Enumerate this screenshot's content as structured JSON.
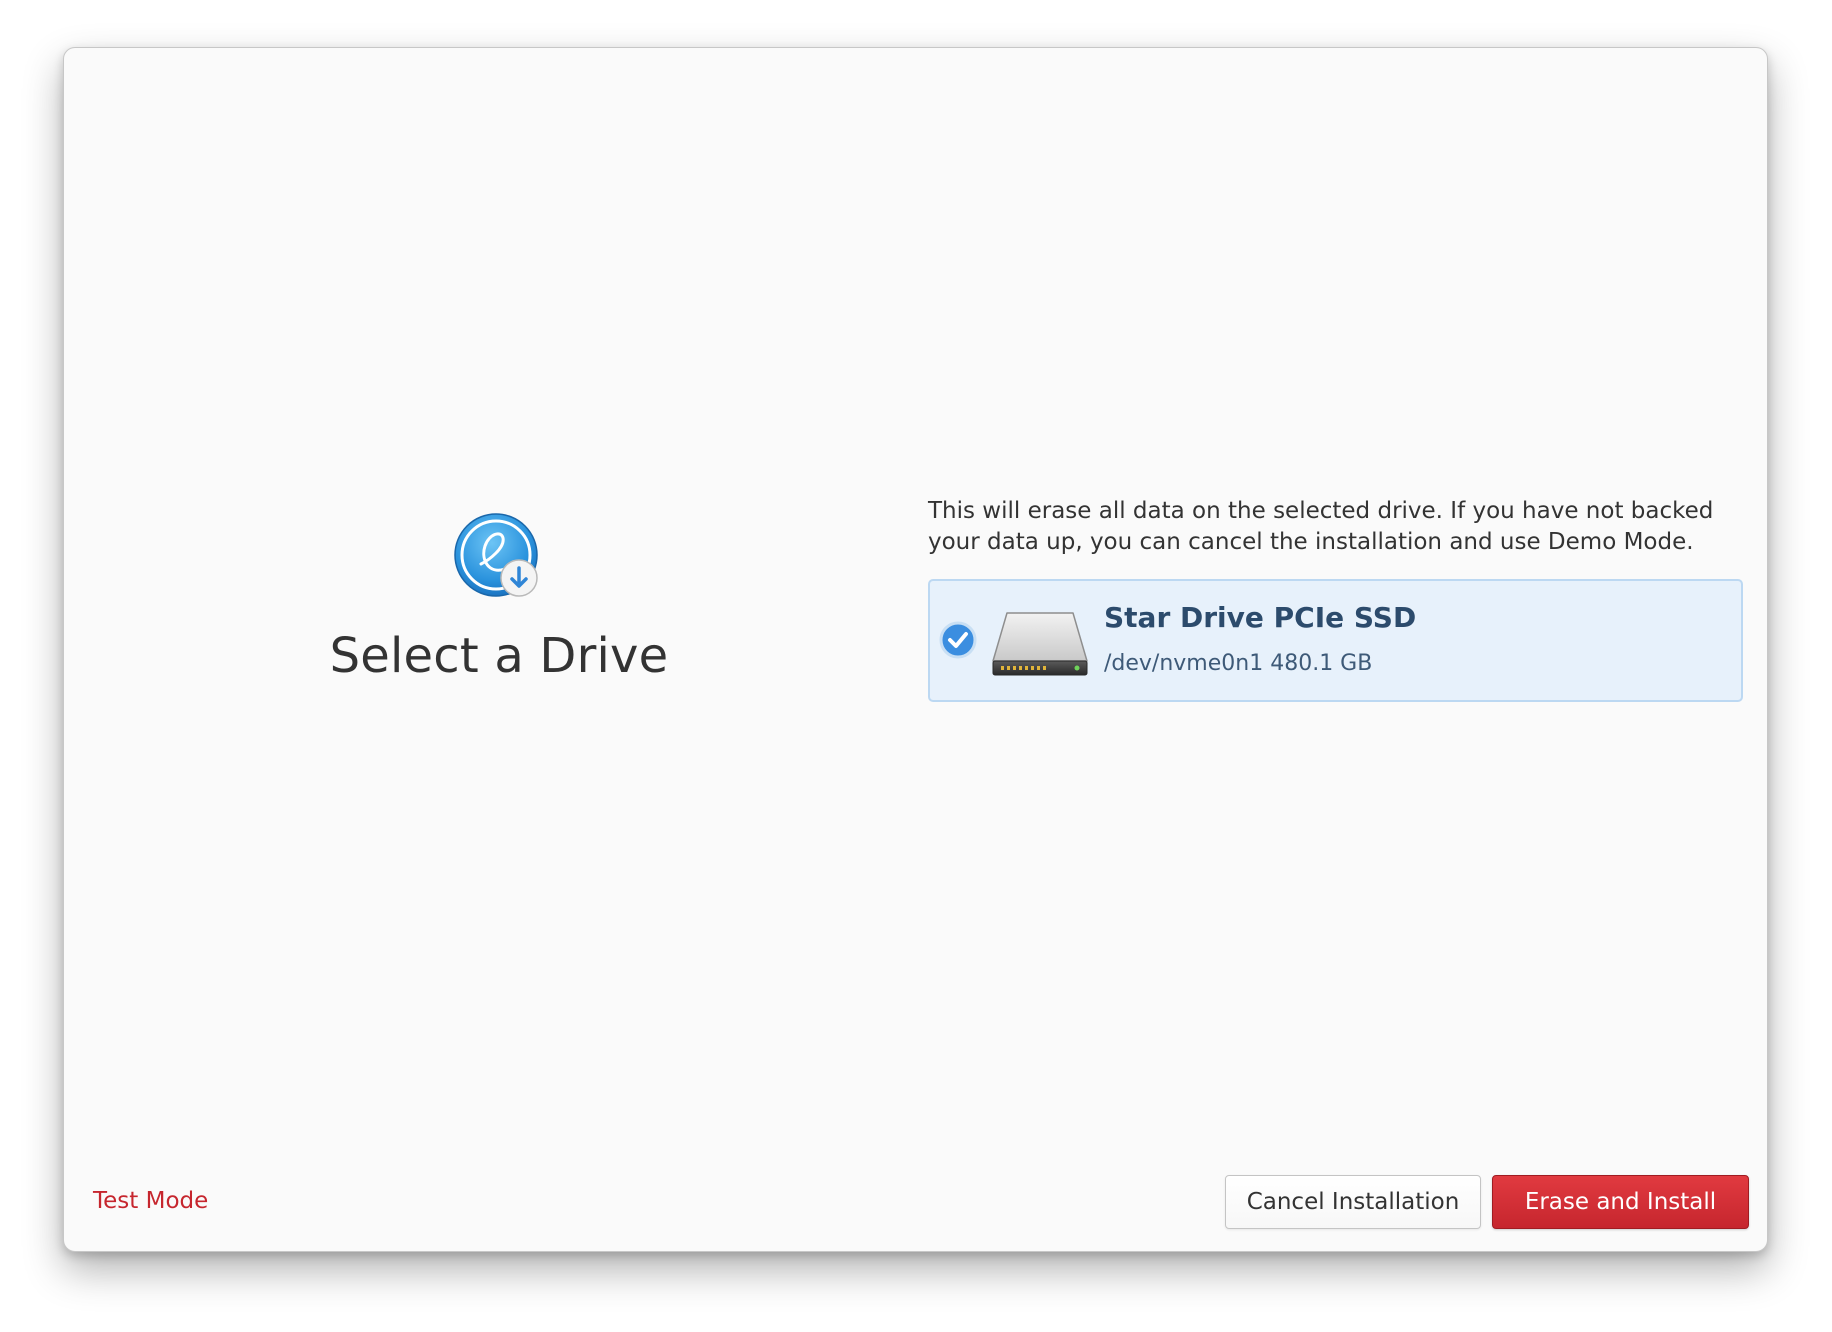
{
  "header": {
    "title": "Select a Drive",
    "app_icon": "installer-icon"
  },
  "main": {
    "warning": "This will erase all data on the selected drive. If you have not backed your data up, you can cancel the installation and use Demo Mode.",
    "drives": [
      {
        "name": "Star Drive PCIe SSD",
        "details": "/dev/nvme0n1 480.1 GB",
        "selected": true,
        "icon": "hard-drive-icon"
      }
    ]
  },
  "footer": {
    "test_mode": "Test Mode",
    "cancel_label": "Cancel Installation",
    "erase_label": "Erase and Install"
  },
  "colors": {
    "accent_red": "#c6262e",
    "selection_bg": "#e7f1fb",
    "selection_border": "#bcd8f2",
    "check_blue": "#3b8ee0"
  }
}
